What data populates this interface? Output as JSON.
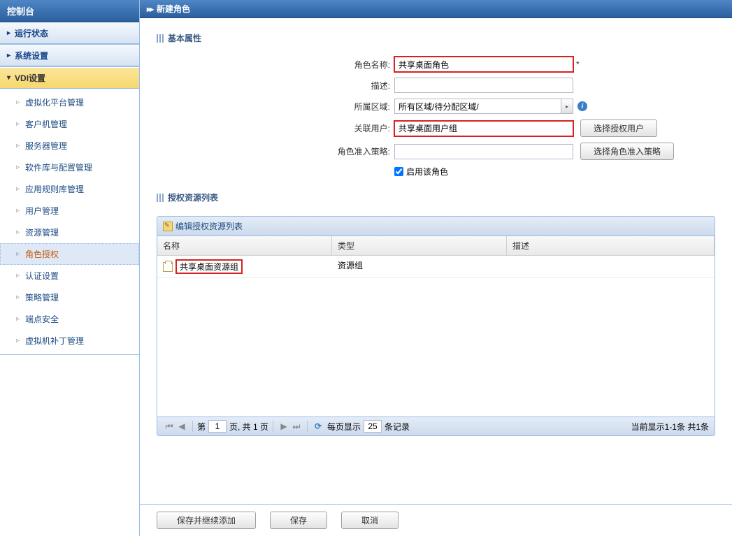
{
  "sidebar": {
    "title": "控制台",
    "panels": [
      {
        "label": "运行状态",
        "expanded": false
      },
      {
        "label": "系统设置",
        "expanded": false
      },
      {
        "label": "VDI设置",
        "expanded": true,
        "active": true
      }
    ],
    "vdi_items": [
      {
        "label": "虚拟化平台管理"
      },
      {
        "label": "客户机管理"
      },
      {
        "label": "服务器管理"
      },
      {
        "label": "软件库与配置管理"
      },
      {
        "label": "应用规则库管理"
      },
      {
        "label": "用户管理"
      },
      {
        "label": "资源管理"
      },
      {
        "label": "角色授权",
        "selected": true
      },
      {
        "label": "认证设置"
      },
      {
        "label": "策略管理"
      },
      {
        "label": "端点安全"
      },
      {
        "label": "虚拟机补丁管理"
      }
    ]
  },
  "breadcrumb": {
    "title": "新建角色"
  },
  "section_basic": {
    "title": "基本属性"
  },
  "form": {
    "role_name": {
      "label": "角色名称:",
      "value": "共享桌面角色",
      "required": "*"
    },
    "desc": {
      "label": "描述:",
      "value": ""
    },
    "region": {
      "label": "所属区域:",
      "value": "所有区域/待分配区域/"
    },
    "assoc_user": {
      "label": "关联用户:",
      "value": "共享桌面用户组",
      "button": "选择授权用户"
    },
    "policy": {
      "label": "角色准入策略:",
      "value": "",
      "button": "选择角色准入策略"
    },
    "enable": {
      "label": "启用该角色"
    }
  },
  "section_resources": {
    "title": "授权资源列表"
  },
  "grid": {
    "toolbar": {
      "edit": "编辑授权资源列表"
    },
    "headers": {
      "name": "名称",
      "type": "类型",
      "desc": "描述"
    },
    "rows": [
      {
        "name": "共享桌面资源组",
        "type": "资源组",
        "desc": ""
      }
    ],
    "pager": {
      "label_page": "第",
      "current": "1",
      "label_of": "页, 共 1 页",
      "label_per": "每页显示",
      "per_page": "25",
      "label_records": "条记录",
      "summary": "当前显示1-1条 共1条"
    }
  },
  "buttons": {
    "save_continue": "保存并继续添加",
    "save": "保存",
    "cancel": "取消"
  }
}
